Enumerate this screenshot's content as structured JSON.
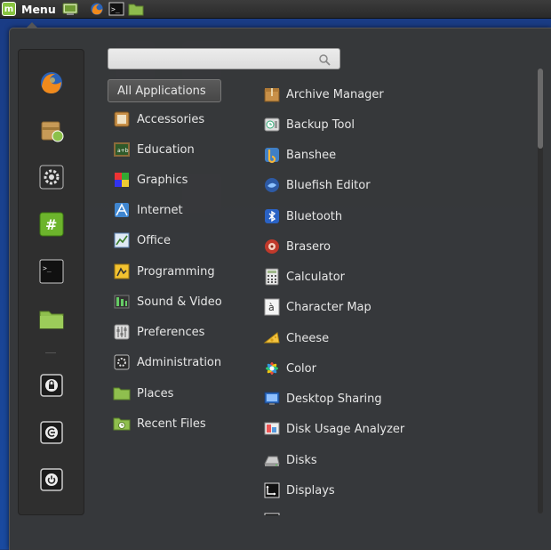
{
  "panel": {
    "menu_label": "Menu",
    "launchers": [
      "show-desktop-icon",
      "firefox-icon",
      "terminal-icon",
      "folder-icon"
    ]
  },
  "favorites": [
    "firefox",
    "software-manager",
    "system-settings",
    "terminal-hash",
    "terminal",
    "home-folder",
    "lock-screen",
    "logout",
    "shutdown"
  ],
  "search": {
    "value": "",
    "placeholder": ""
  },
  "categories": [
    {
      "label": "All Applications",
      "icon": "none",
      "active": true
    },
    {
      "label": "Accessories",
      "icon": "accessories-icon"
    },
    {
      "label": "Education",
      "icon": "education-icon"
    },
    {
      "label": "Graphics",
      "icon": "graphics-icon"
    },
    {
      "label": "Internet",
      "icon": "internet-icon"
    },
    {
      "label": "Office",
      "icon": "office-icon"
    },
    {
      "label": "Programming",
      "icon": "programming-icon"
    },
    {
      "label": "Sound & Video",
      "icon": "sound-video-icon"
    },
    {
      "label": "Preferences",
      "icon": "preferences-icon"
    },
    {
      "label": "Administration",
      "icon": "administration-icon"
    },
    {
      "label": "Places",
      "icon": "places-icon"
    },
    {
      "label": "Recent Files",
      "icon": "recent-files-icon"
    }
  ],
  "apps": [
    {
      "label": "Archive Manager",
      "icon": "archive-icon"
    },
    {
      "label": "Backup Tool",
      "icon": "backup-icon"
    },
    {
      "label": "Banshee",
      "icon": "banshee-icon"
    },
    {
      "label": "Bluefish Editor",
      "icon": "bluefish-icon"
    },
    {
      "label": "Bluetooth",
      "icon": "bluetooth-icon"
    },
    {
      "label": "Brasero",
      "icon": "brasero-icon"
    },
    {
      "label": "Calculator",
      "icon": "calculator-icon"
    },
    {
      "label": "Character Map",
      "icon": "character-map-icon"
    },
    {
      "label": "Cheese",
      "icon": "cheese-icon"
    },
    {
      "label": "Color",
      "icon": "color-icon"
    },
    {
      "label": "Desktop Sharing",
      "icon": "desktop-sharing-icon"
    },
    {
      "label": "Disk Usage Analyzer",
      "icon": "disk-usage-icon"
    },
    {
      "label": "Disks",
      "icon": "disks-icon"
    },
    {
      "label": "Displays",
      "icon": "displays-icon"
    }
  ],
  "colors": {
    "accent": "#88c440",
    "menu_bg": "#383838",
    "text": "#e6e6e6"
  }
}
